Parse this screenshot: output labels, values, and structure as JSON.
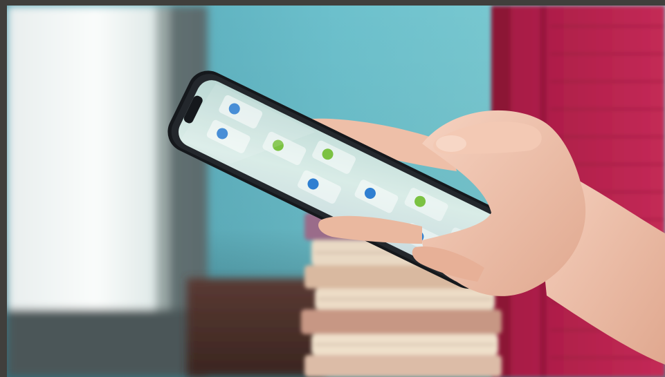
{
  "scene": {
    "subject": "hand-holding-smartphone",
    "colors": {
      "frame": "#403f3c",
      "wall_teal": "#5fb3c2",
      "shutter_red": "#b01f4a",
      "window_light": "#f2f4f3",
      "book_cream": "#e8d6bf",
      "phone_body": "#1b1e22",
      "screen_bg": "#cfe6e2",
      "skin": "#f0c6b2",
      "app_blue": "#2f7fd1",
      "app_green": "#7bc242"
    }
  }
}
